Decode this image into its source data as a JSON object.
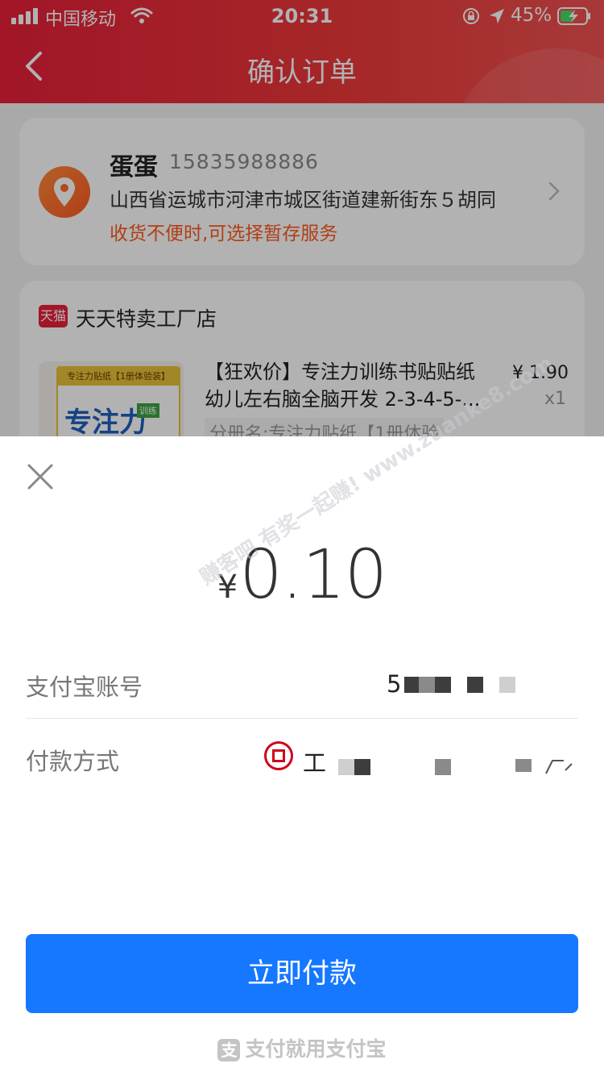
{
  "status_bar": {
    "carrier": "中国移动",
    "time": "20:31",
    "battery_percent": "45%"
  },
  "nav": {
    "title": "确认订单"
  },
  "address": {
    "name": "蛋蛋",
    "phone": "15835988886",
    "line": "山西省运城市河津市城区街道建新街东５胡同",
    "tip": "收货不便时,可选择暂存服务"
  },
  "shop": {
    "badge": "天猫",
    "name": "天天特卖工厂店",
    "product": {
      "title": "【狂欢价】专注力训练书贴贴纸幼儿左右脑全脑开发 2-3-4-5-...",
      "sku": "分册名:专注力贴纸【1册体验",
      "price": "¥ 1.90",
      "qty": "x1",
      "cover_top": "专注力贴纸【1册体验装】",
      "cover_big": "专注力",
      "cover_tag": "训练"
    }
  },
  "payment": {
    "currency": "¥",
    "amount": "0.10",
    "watermark": "赚客吧 有奖一起赚! www.zuanke8.com",
    "account_label": "支付宝账号",
    "account_value": "5",
    "method_label": "付款方式",
    "method_value": "工",
    "pay_button": "立即付款",
    "footer": "支付就用支付宝",
    "footer_logo": "支"
  },
  "colors": {
    "header_red": "#e8203a",
    "pay_blue": "#1677ff",
    "tip_orange": "#ff5a1f"
  },
  "icons": [
    "signal-icon",
    "wifi-icon",
    "lock-rotation-icon",
    "location-arrow-icon",
    "battery-icon",
    "back-arrow-icon",
    "location-pin-icon",
    "chevron-right-icon",
    "close-icon",
    "icbc-logo-icon",
    "alipay-logo-icon"
  ]
}
